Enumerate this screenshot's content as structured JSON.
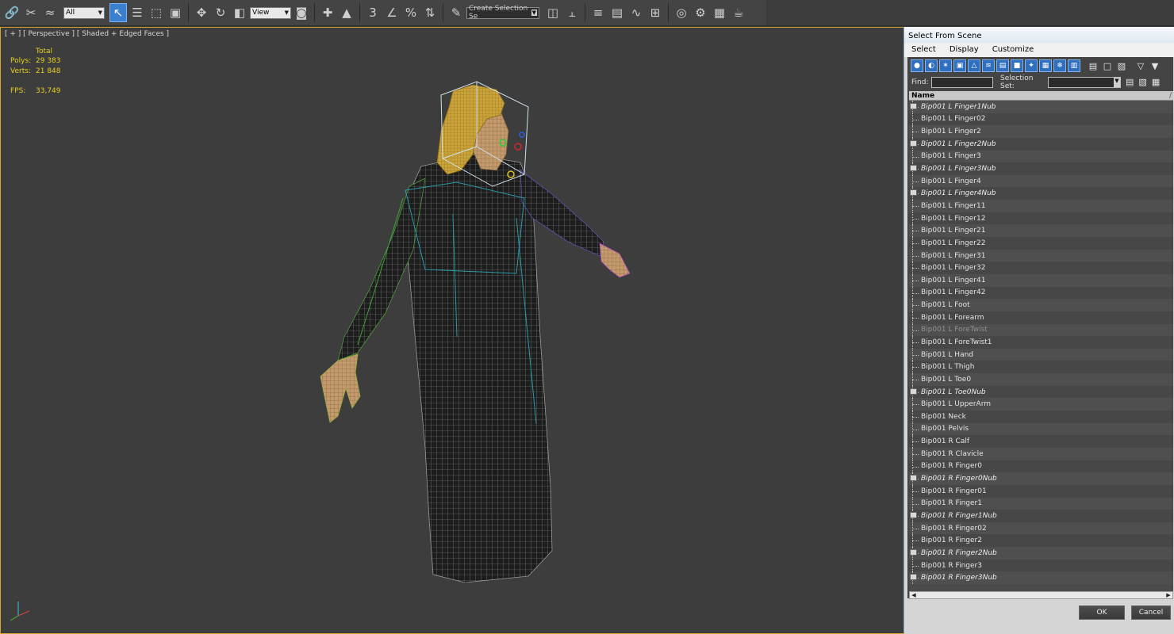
{
  "toolbar": {
    "filter_select": "All",
    "coord_select": "View",
    "selection_set_select": "Create Selection Se",
    "snap_label": "3",
    "percent_label": "%",
    "icons": [
      "link-icon",
      "unlink-icon",
      "bind-spacewarp-icon",
      "select-object-icon",
      "select-by-name-icon",
      "rect-region-icon",
      "window-crossing-icon",
      "move-icon",
      "rotate-icon",
      "scale-icon",
      "pivot-icon",
      "manipulate-icon",
      "snap-icon",
      "angle-snap-icon",
      "percent-snap-icon",
      "spinner-snap-icon",
      "edit-named-sets-icon",
      "mirror-icon",
      "align-icon",
      "layer-manager-icon",
      "scene-explorer-icon",
      "curve-editor-icon",
      "schematic-view-icon",
      "material-editor-icon",
      "render-setup-icon",
      "rendered-frame-icon",
      "render-icon"
    ]
  },
  "viewport": {
    "label": "[ + ] [ Perspective ] [ Shaded + Edged Faces ]",
    "stats": {
      "total_label": "Total",
      "polys_label": "Polys:",
      "polys_value": "29 383",
      "verts_label": "Verts:",
      "verts_value": "21 848",
      "fps_label": "FPS:",
      "fps_value": "33,749"
    },
    "colors": {
      "border": "#d4a531",
      "stats": "#e8d020",
      "background": "#3d3d3d"
    }
  },
  "dialog": {
    "title": "Select From Scene",
    "menu": [
      "Select",
      "Display",
      "Customize"
    ],
    "find_label": "Find:",
    "find_value": "",
    "selection_set_label": "Selection Set:",
    "selection_set_value": "",
    "column_header": "Name",
    "items": [
      {
        "name": "Bip001 L Finger1Nub",
        "italic": true,
        "dim": false
      },
      {
        "name": "Bip001 L Finger02",
        "italic": false,
        "dim": false
      },
      {
        "name": "Bip001 L Finger2",
        "italic": false,
        "dim": false
      },
      {
        "name": "Bip001 L Finger2Nub",
        "italic": true,
        "dim": false
      },
      {
        "name": "Bip001 L Finger3",
        "italic": false,
        "dim": false
      },
      {
        "name": "Bip001 L Finger3Nub",
        "italic": true,
        "dim": false
      },
      {
        "name": "Bip001 L Finger4",
        "italic": false,
        "dim": false
      },
      {
        "name": "Bip001 L Finger4Nub",
        "italic": true,
        "dim": false
      },
      {
        "name": "Bip001 L Finger11",
        "italic": false,
        "dim": false
      },
      {
        "name": "Bip001 L Finger12",
        "italic": false,
        "dim": false
      },
      {
        "name": "Bip001 L Finger21",
        "italic": false,
        "dim": false
      },
      {
        "name": "Bip001 L Finger22",
        "italic": false,
        "dim": false
      },
      {
        "name": "Bip001 L Finger31",
        "italic": false,
        "dim": false
      },
      {
        "name": "Bip001 L Finger32",
        "italic": false,
        "dim": false
      },
      {
        "name": "Bip001 L Finger41",
        "italic": false,
        "dim": false
      },
      {
        "name": "Bip001 L Finger42",
        "italic": false,
        "dim": false
      },
      {
        "name": "Bip001 L Foot",
        "italic": false,
        "dim": false
      },
      {
        "name": "Bip001 L Forearm",
        "italic": false,
        "dim": false
      },
      {
        "name": "Bip001 L ForeTwist",
        "italic": false,
        "dim": true
      },
      {
        "name": "Bip001 L ForeTwist1",
        "italic": false,
        "dim": false
      },
      {
        "name": "Bip001 L Hand",
        "italic": false,
        "dim": false
      },
      {
        "name": "Bip001 L Thigh",
        "italic": false,
        "dim": false
      },
      {
        "name": "Bip001 L Toe0",
        "italic": false,
        "dim": false
      },
      {
        "name": "Bip001 L Toe0Nub",
        "italic": true,
        "dim": false
      },
      {
        "name": "Bip001 L UpperArm",
        "italic": false,
        "dim": false
      },
      {
        "name": "Bip001 Neck",
        "italic": false,
        "dim": false
      },
      {
        "name": "Bip001 Pelvis",
        "italic": false,
        "dim": false
      },
      {
        "name": "Bip001 R Calf",
        "italic": false,
        "dim": false
      },
      {
        "name": "Bip001 R Clavicle",
        "italic": false,
        "dim": false
      },
      {
        "name": "Bip001 R Finger0",
        "italic": false,
        "dim": false
      },
      {
        "name": "Bip001 R Finger0Nub",
        "italic": true,
        "dim": false
      },
      {
        "name": "Bip001 R Finger01",
        "italic": false,
        "dim": false
      },
      {
        "name": "Bip001 R Finger1",
        "italic": false,
        "dim": false
      },
      {
        "name": "Bip001 R Finger1Nub",
        "italic": true,
        "dim": false
      },
      {
        "name": "Bip001 R Finger02",
        "italic": false,
        "dim": false
      },
      {
        "name": "Bip001 R Finger2",
        "italic": false,
        "dim": false
      },
      {
        "name": "Bip001 R Finger2Nub",
        "italic": true,
        "dim": false
      },
      {
        "name": "Bip001 R Finger3",
        "italic": false,
        "dim": false
      },
      {
        "name": "Bip001 R Finger3Nub",
        "italic": true,
        "dim": false
      }
    ],
    "ok_label": "OK",
    "cancel_label": "Cancel"
  }
}
